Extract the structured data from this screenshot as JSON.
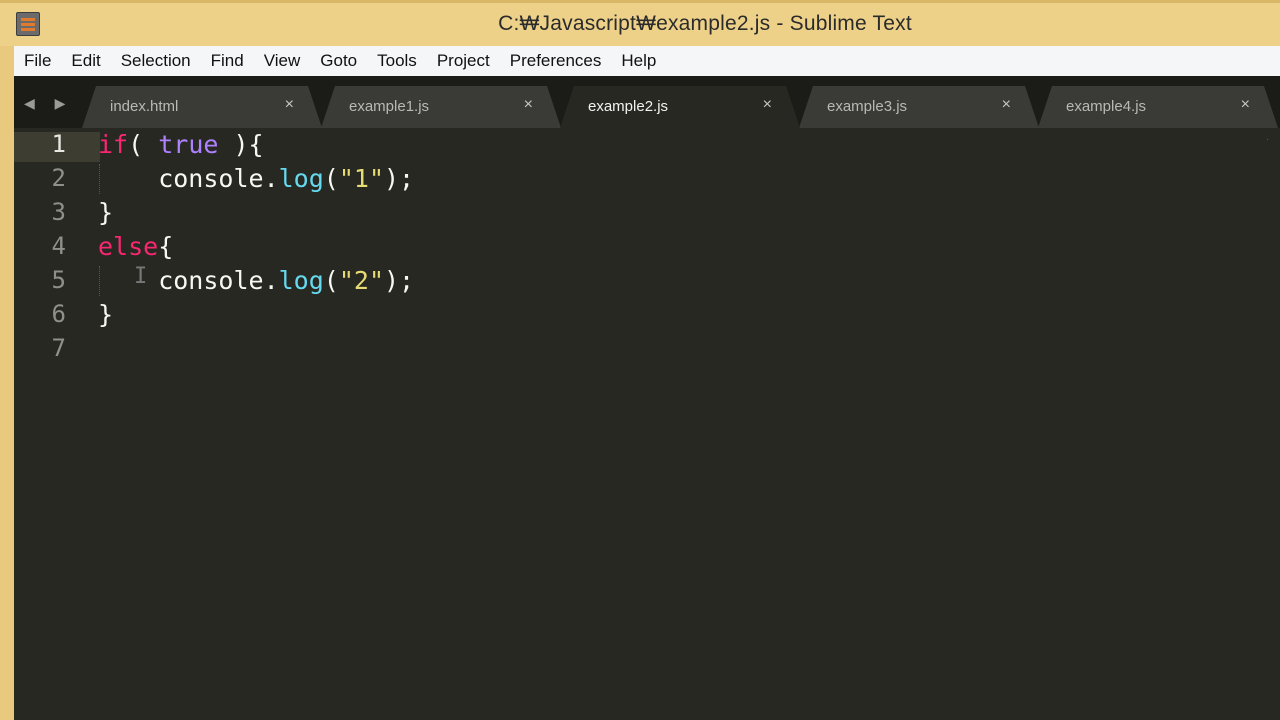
{
  "window": {
    "title": "C:₩Javascript₩example2.js - Sublime Text"
  },
  "menu": [
    "File",
    "Edit",
    "Selection",
    "Find",
    "View",
    "Goto",
    "Tools",
    "Project",
    "Preferences",
    "Help"
  ],
  "tabs": [
    {
      "label": "index.html",
      "active": false
    },
    {
      "label": "example1.js",
      "active": false
    },
    {
      "label": "example2.js",
      "active": true
    },
    {
      "label": "example3.js",
      "active": false
    },
    {
      "label": "example4.js",
      "active": false
    }
  ],
  "tab_close_glyph": "×",
  "tab_nav": "◀ ▶",
  "editor": {
    "active_line": 1,
    "line_numbers": [
      "1",
      "2",
      "3",
      "4",
      "5",
      "6",
      "7"
    ],
    "lines": {
      "l1": {
        "kw": "if",
        "p1": "( ",
        "const": "true",
        "p2": " ){"
      },
      "l2": {
        "ident": "    console.",
        "fn": "log",
        "p1": "(",
        "str": "\"1\"",
        "p2": ");"
      },
      "l3": {
        "text": "}"
      },
      "l4": {
        "kw": "else",
        "p1": "{"
      },
      "l5": {
        "ident": "    console.",
        "fn": "log",
        "p1": "(",
        "str": "\"2\"",
        "p2": ");"
      },
      "l6": {
        "text": "}"
      },
      "l7": {
        "text": ""
      }
    }
  },
  "colors": {
    "editor_bg": "#272822",
    "keyword": "#f92672",
    "constant": "#ae81ff",
    "function": "#66d9ef",
    "string": "#e6db74",
    "title_bar": "#edd189"
  }
}
